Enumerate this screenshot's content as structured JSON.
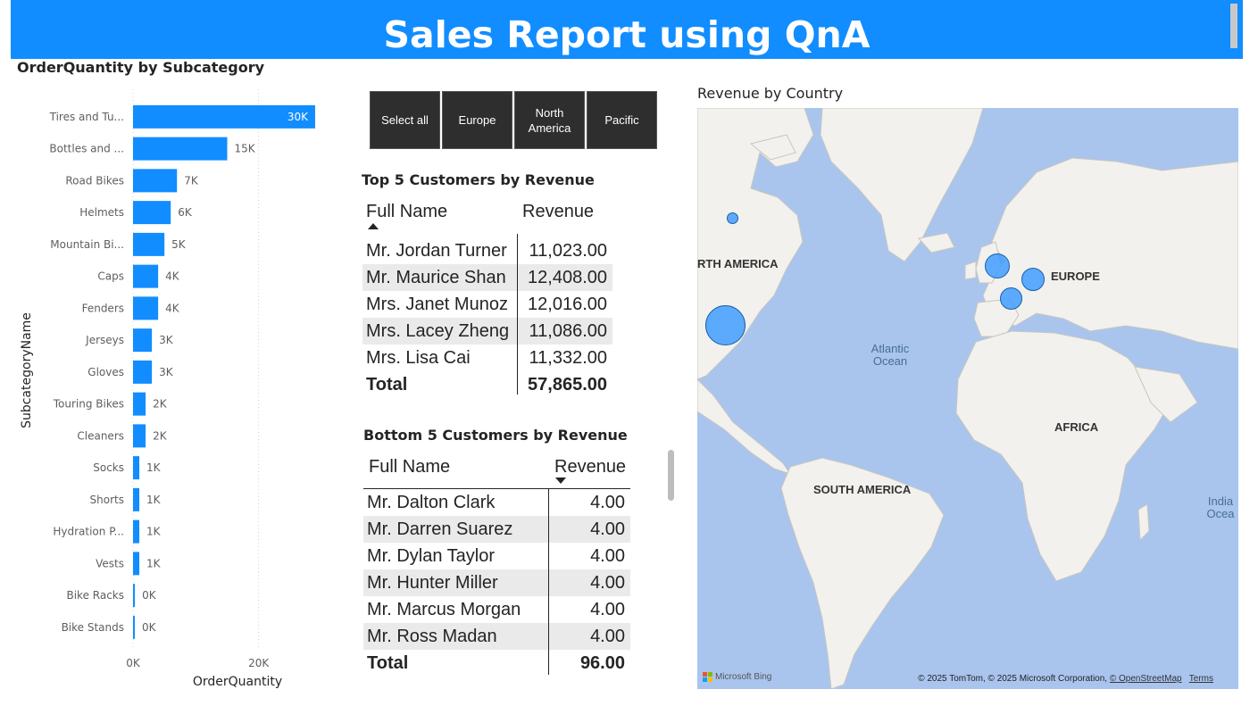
{
  "header": {
    "title": "Sales Report using QnA"
  },
  "bar_chart": {
    "title": "OrderQuantity by Subcategory"
  },
  "chart_data": {
    "type": "bar",
    "orientation": "horizontal",
    "title": "OrderQuantity by Subcategory",
    "xlabel": "OrderQuantity",
    "ylabel": "SubcategoryName",
    "categories": [
      "Tires and Tu...",
      "Bottles and ...",
      "Road Bikes",
      "Helmets",
      "Mountain Bi...",
      "Caps",
      "Fenders",
      "Jerseys",
      "Gloves",
      "Touring Bikes",
      "Cleaners",
      "Socks",
      "Shorts",
      "Hydration P...",
      "Vests",
      "Bike Racks",
      "Bike Stands"
    ],
    "values": [
      29000,
      15000,
      7000,
      6000,
      5000,
      4000,
      4000,
      3000,
      3000,
      2000,
      2000,
      1000,
      1000,
      1000,
      1000,
      300,
      250
    ],
    "data_labels": [
      "30K",
      "15K",
      "7K",
      "6K",
      "5K",
      "4K",
      "4K",
      "3K",
      "3K",
      "2K",
      "2K",
      "1K",
      "1K",
      "1K",
      "1K",
      "0K",
      "0K"
    ],
    "xlim": [
      0,
      30000
    ],
    "x_ticks": [
      {
        "value": 0,
        "label": "0K"
      },
      {
        "value": 20000,
        "label": "20K"
      }
    ],
    "grid": true,
    "color": "#118dff"
  },
  "slicer": {
    "buttons": [
      "Select all",
      "Europe",
      "North America",
      "Pacific"
    ]
  },
  "top_table": {
    "title": "Top 5 Customers by Revenue",
    "col_name": "Full Name",
    "col_revenue": "Revenue",
    "rows": [
      {
        "name": "Mr. Jordan Turner",
        "revenue": "11,023.00"
      },
      {
        "name": "Mr. Maurice Shan",
        "revenue": "12,408.00"
      },
      {
        "name": "Mrs. Janet Munoz",
        "revenue": "12,016.00"
      },
      {
        "name": "Mrs. Lacey Zheng",
        "revenue": "11,086.00"
      },
      {
        "name": "Mrs. Lisa Cai",
        "revenue": "11,332.00"
      }
    ],
    "total_label": "Total",
    "total_value": "57,865.00"
  },
  "bottom_table": {
    "title": "Bottom 5 Customers by Revenue",
    "col_name": "Full Name",
    "col_revenue": "Revenue",
    "rows": [
      {
        "name": "Mr. Dalton Clark",
        "revenue": "4.00"
      },
      {
        "name": "Mr. Darren Suarez",
        "revenue": "4.00"
      },
      {
        "name": "Mr. Dylan Taylor",
        "revenue": "4.00"
      },
      {
        "name": "Mr. Hunter Miller",
        "revenue": "4.00"
      },
      {
        "name": "Mr. Marcus Morgan",
        "revenue": "4.00"
      },
      {
        "name": "Mr. Ross Madan",
        "revenue": "4.00"
      }
    ],
    "total_label": "Total",
    "total_value": "96.00"
  },
  "map": {
    "title": "Revenue by Country",
    "labels": {
      "north_america": "RTH AMERICA",
      "europe": "EUROPE",
      "atlantic": "Atlantic Ocean",
      "africa": "AFRICA",
      "south_america": "SOUTH AMERICA",
      "indian": "India Ocea"
    },
    "attribution": "© 2025 TomTom, © 2025 Microsoft Corporation,",
    "osm_link": "© OpenStreetMap",
    "terms_link": "Terms",
    "bing": "Microsoft Bing",
    "ocean_color": "#a9c5ee",
    "land_color": "#f2f1ee",
    "bubble_color": "#419dff"
  }
}
